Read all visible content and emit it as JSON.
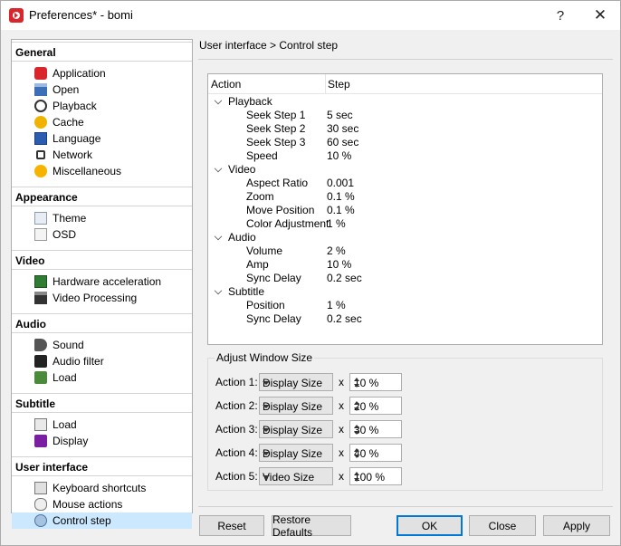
{
  "window": {
    "title": "Preferences* - bomi",
    "help_glyph": "?",
    "close_glyph": "✕"
  },
  "nav": {
    "sections": [
      {
        "label": "General",
        "items": [
          {
            "label": "Application",
            "icon": "bomi-app-icon"
          },
          {
            "label": "Open",
            "icon": "open-folder-icon"
          },
          {
            "label": "Playback",
            "icon": "play-circle-icon"
          },
          {
            "label": "Cache",
            "icon": "cache-icon"
          },
          {
            "label": "Language",
            "icon": "language-flag-icon"
          },
          {
            "label": "Network",
            "icon": "network-icon"
          },
          {
            "label": "Miscellaneous",
            "icon": "misc-gear-icon"
          }
        ]
      },
      {
        "label": "Appearance",
        "items": [
          {
            "label": "Theme",
            "icon": "theme-icon"
          },
          {
            "label": "OSD",
            "icon": "osd-icon"
          }
        ]
      },
      {
        "label": "Video",
        "items": [
          {
            "label": "Hardware acceleration",
            "icon": "hardware-icon"
          },
          {
            "label": "Video Processing",
            "icon": "clapper-icon"
          }
        ]
      },
      {
        "label": "Audio",
        "items": [
          {
            "label": "Sound",
            "icon": "speaker-icon"
          },
          {
            "label": "Audio filter",
            "icon": "audio-filter-icon"
          },
          {
            "label": "Load",
            "icon": "audio-load-icon"
          }
        ]
      },
      {
        "label": "Subtitle",
        "items": [
          {
            "label": "Load",
            "icon": "subtitle-load-icon"
          },
          {
            "label": "Display",
            "icon": "text-display-icon"
          }
        ]
      },
      {
        "label": "User interface",
        "items": [
          {
            "label": "Keyboard shortcuts",
            "icon": "keyboard-icon"
          },
          {
            "label": "Mouse actions",
            "icon": "mouse-icon"
          },
          {
            "label": "Control step",
            "icon": "control-step-icon",
            "selected": true
          }
        ]
      }
    ]
  },
  "breadcrumb": "User interface > Control step",
  "tree": {
    "columns": [
      "Action",
      "Step"
    ],
    "groups": [
      {
        "label": "Playback",
        "rows": [
          {
            "action": "Seek Step 1",
            "step": "5 sec"
          },
          {
            "action": "Seek Step 2",
            "step": "30 sec"
          },
          {
            "action": "Seek Step 3",
            "step": "60 sec"
          },
          {
            "action": "Speed",
            "step": "10 %"
          }
        ]
      },
      {
        "label": "Video",
        "rows": [
          {
            "action": "Aspect Ratio",
            "step": "0.001"
          },
          {
            "action": "Zoom",
            "step": "0.1 %"
          },
          {
            "action": "Move Position",
            "step": "0.1 %"
          },
          {
            "action": "Color Adjustment",
            "step": "1 %"
          }
        ]
      },
      {
        "label": "Audio",
        "rows": [
          {
            "action": "Volume",
            "step": "2 %"
          },
          {
            "action": "Amp",
            "step": "10 %"
          },
          {
            "action": "Sync Delay",
            "step": "0.2 sec"
          }
        ]
      },
      {
        "label": "Subtitle",
        "rows": [
          {
            "action": "Position",
            "step": "1 %"
          },
          {
            "action": "Sync Delay",
            "step": "0.2 sec"
          }
        ]
      }
    ]
  },
  "adjust_window_size": {
    "title": "Adjust Window Size",
    "times": "x",
    "rows": [
      {
        "label": "Action 1:",
        "mode": "Display Size",
        "value": "10 %"
      },
      {
        "label": "Action 2:",
        "mode": "Display Size",
        "value": "20 %"
      },
      {
        "label": "Action 3:",
        "mode": "Display Size",
        "value": "30 %"
      },
      {
        "label": "Action 4:",
        "mode": "Display Size",
        "value": "40 %"
      },
      {
        "label": "Action 5:",
        "mode": "Video Size",
        "value": "100 %"
      }
    ]
  },
  "buttons": {
    "reset": "Reset",
    "restore_defaults": "Restore Defaults",
    "ok": "OK",
    "close": "Close",
    "apply": "Apply"
  },
  "colors": {
    "selection": "#cce8ff",
    "primary_border": "#0078d7",
    "app_red": "#d9262c"
  }
}
